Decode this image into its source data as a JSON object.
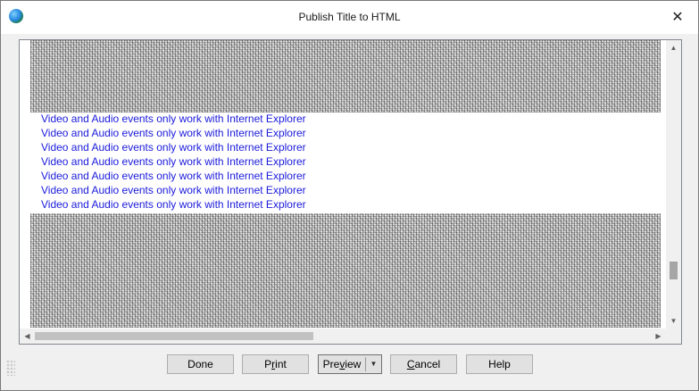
{
  "window": {
    "title": "Publish Title to HTML",
    "close_glyph": "✕",
    "app_icon": "globe-icon"
  },
  "log": {
    "messages": [
      "Video and Audio events only work with Internet Explorer",
      "Video and Audio events only work with Internet Explorer",
      "Video and Audio events only work with Internet Explorer",
      "Video and Audio events only work with Internet Explorer",
      "Video and Audio events only work with Internet Explorer",
      "Video and Audio events only work with Internet Explorer",
      "Video and Audio events only work with Internet Explorer"
    ],
    "link_color": "#1a1adc"
  },
  "scrollbars": {
    "up_glyph": "▲",
    "down_glyph": "▼",
    "left_glyph": "◀",
    "right_glyph": "▶"
  },
  "buttons": {
    "done": "Done",
    "print_pre": "P",
    "print_accel": "r",
    "print_post": "int",
    "preview_pre": "Pre",
    "preview_accel": "v",
    "preview_post": "iew",
    "preview_dropdown_glyph": "▼",
    "cancel_accel": "C",
    "cancel_post": "ancel",
    "help": "Help"
  }
}
